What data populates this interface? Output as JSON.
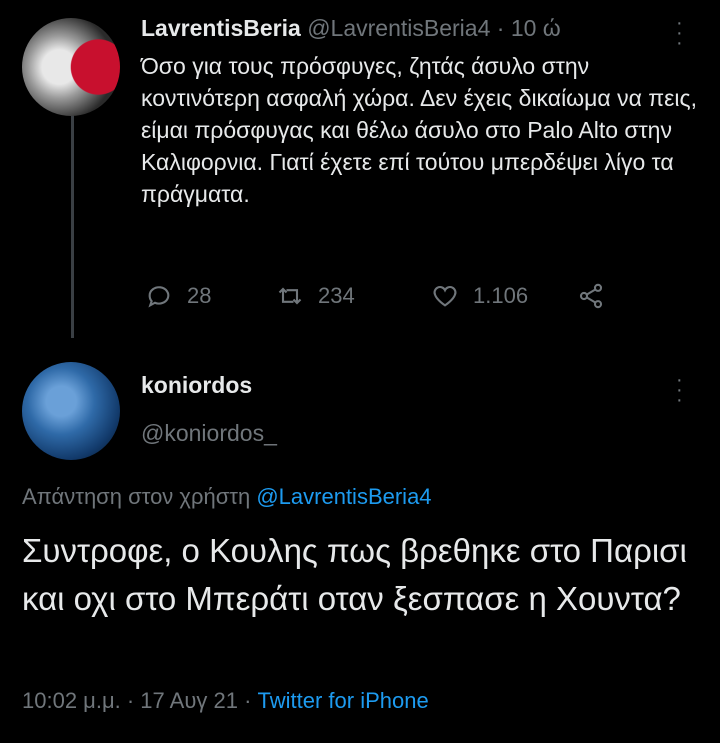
{
  "tweet1": {
    "display_name": "LavrentisBeria",
    "handle": "@LavrentisBeria4",
    "time": "10 ώ",
    "text": "Όσο για τους πρόσφυγες, ζητάς άσυλο στην κοντινότερη ασφαλή χώρα. Δεν έχεις δικαίωμα να πεις, είμαι πρόσφυγας και θέλω άσυλο στο Palo Alto στην Καλιφορνια. Γιατί έχετε επί τούτου μπερδέψει λίγο τα πράγματα.",
    "replies": "28",
    "retweets": "234",
    "likes": "1.106",
    "icons": [
      "reply-icon",
      "retweet-icon",
      "like-icon",
      "share-icon",
      "more-icon"
    ]
  },
  "tweet2": {
    "display_name": "koniordos",
    "handle": "@koniordos_",
    "reply_prefix": "Απάντηση στον χρήστη",
    "reply_to": "@LavrentisBeria4",
    "text": "Συντροφε, ο Κουλης πως βρεθηκε στο Παρισι και οχι στο Μπεράτι οταν ξεσπασε η Χουντα?",
    "timestamp": "10:02 μ.μ. · 17 Αυγ 21 · ",
    "source": "Twitter for iPhone"
  },
  "colors": {
    "background": "#000000",
    "link": "#1d9bf0",
    "muted": "#70767b",
    "text": "#e7e9ea"
  }
}
